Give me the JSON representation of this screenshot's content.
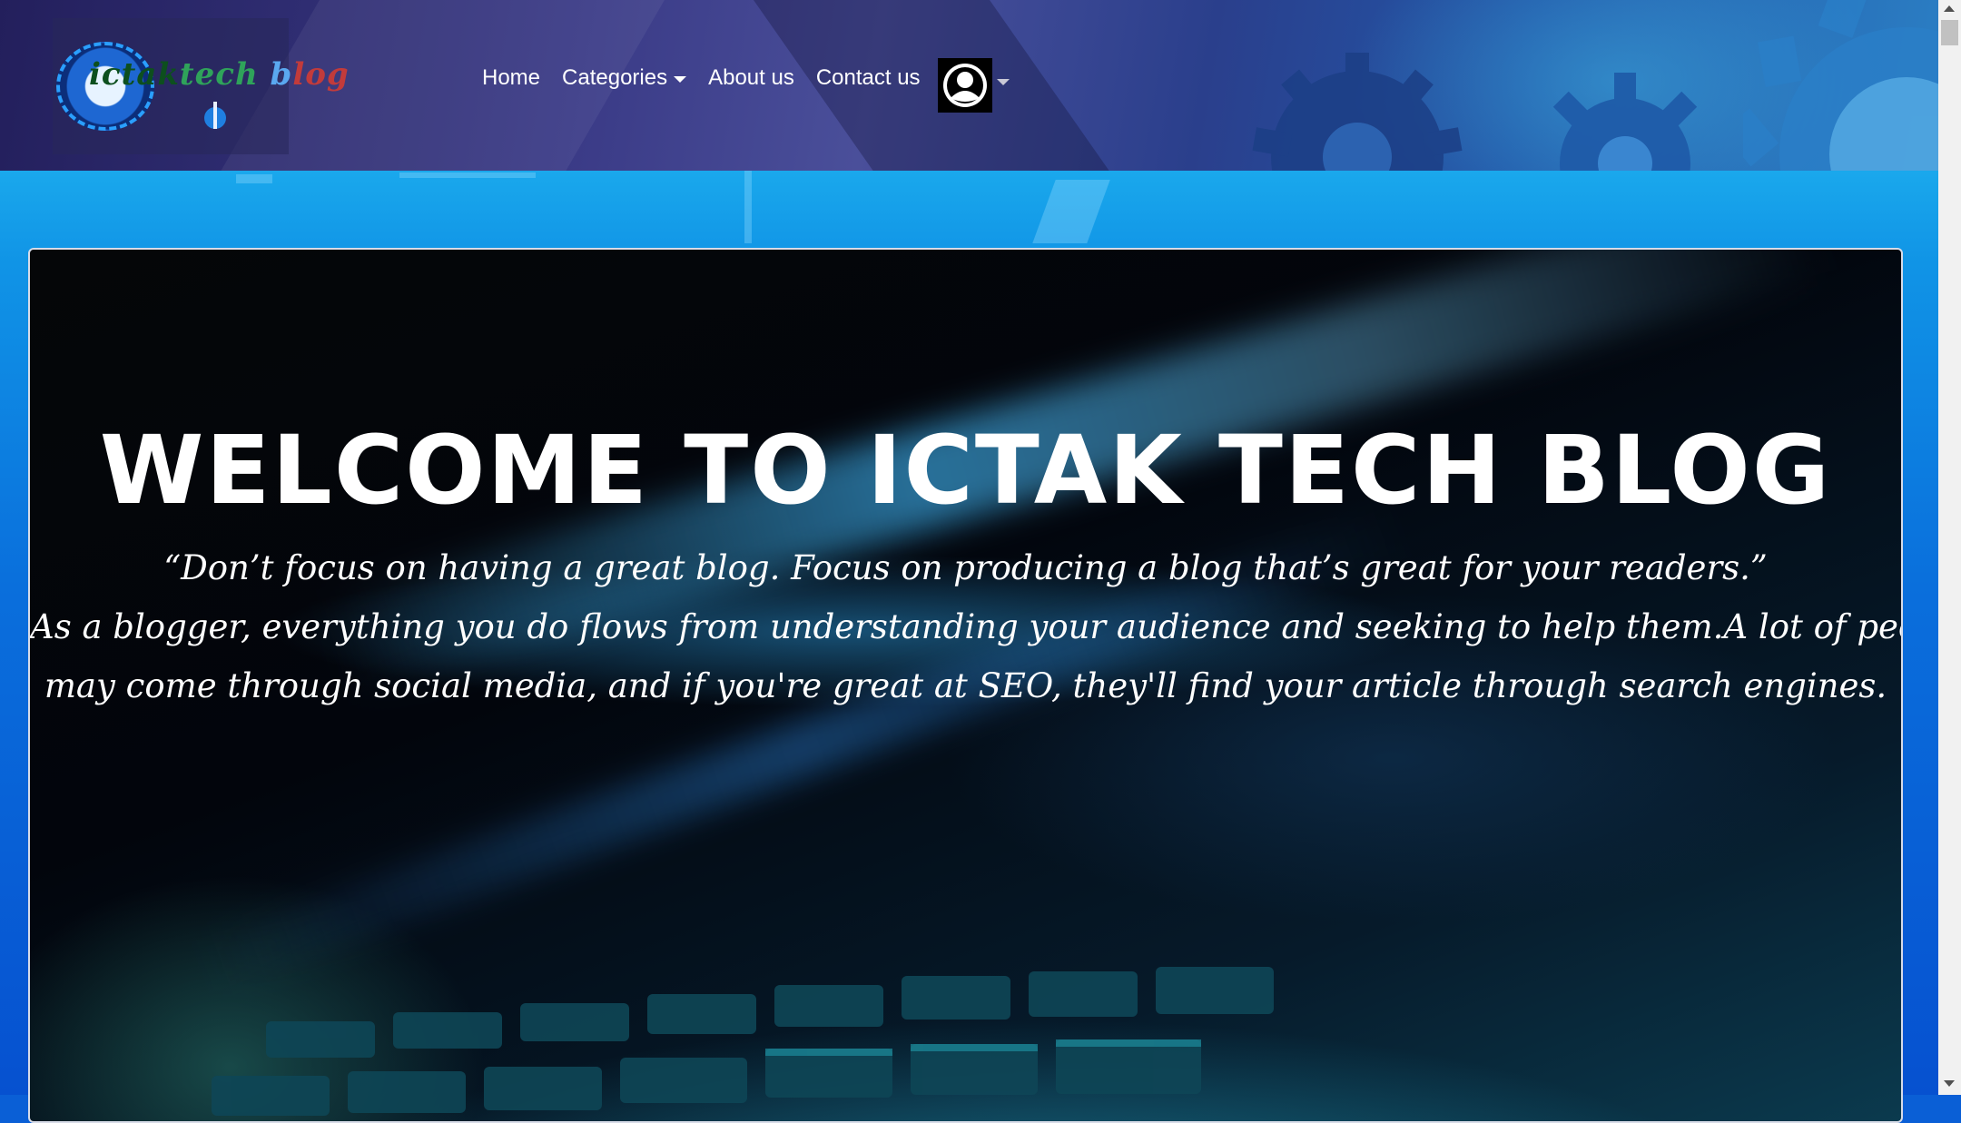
{
  "colors": {
    "header_bg": "#3a3a86",
    "main_bg": "#0a6fdc",
    "hero_bg": "#02050c",
    "text": "#ffffff"
  },
  "logo": {
    "part1": "ictak",
    "part2": "tech",
    "part3": "b",
    "part4": "log",
    "icon": "logo-emblem"
  },
  "nav": {
    "home": "Home",
    "categories": "Categories",
    "about": "About us",
    "contact": "Contact us",
    "user_icon": "user-avatar-icon"
  },
  "hero": {
    "title": "WELCOME TO ICTAK TECH BLOG",
    "quote_line1": "“Don’t focus on having a great blog. Focus on producing a blog that’s great for your readers.”",
    "quote_line2": "As a blogger, everything you do flows from understanding your audience and seeking to help them.A lot of people",
    "quote_line3": "may come through social media, and if you're great at SEO, they'll find your article through search engines."
  }
}
